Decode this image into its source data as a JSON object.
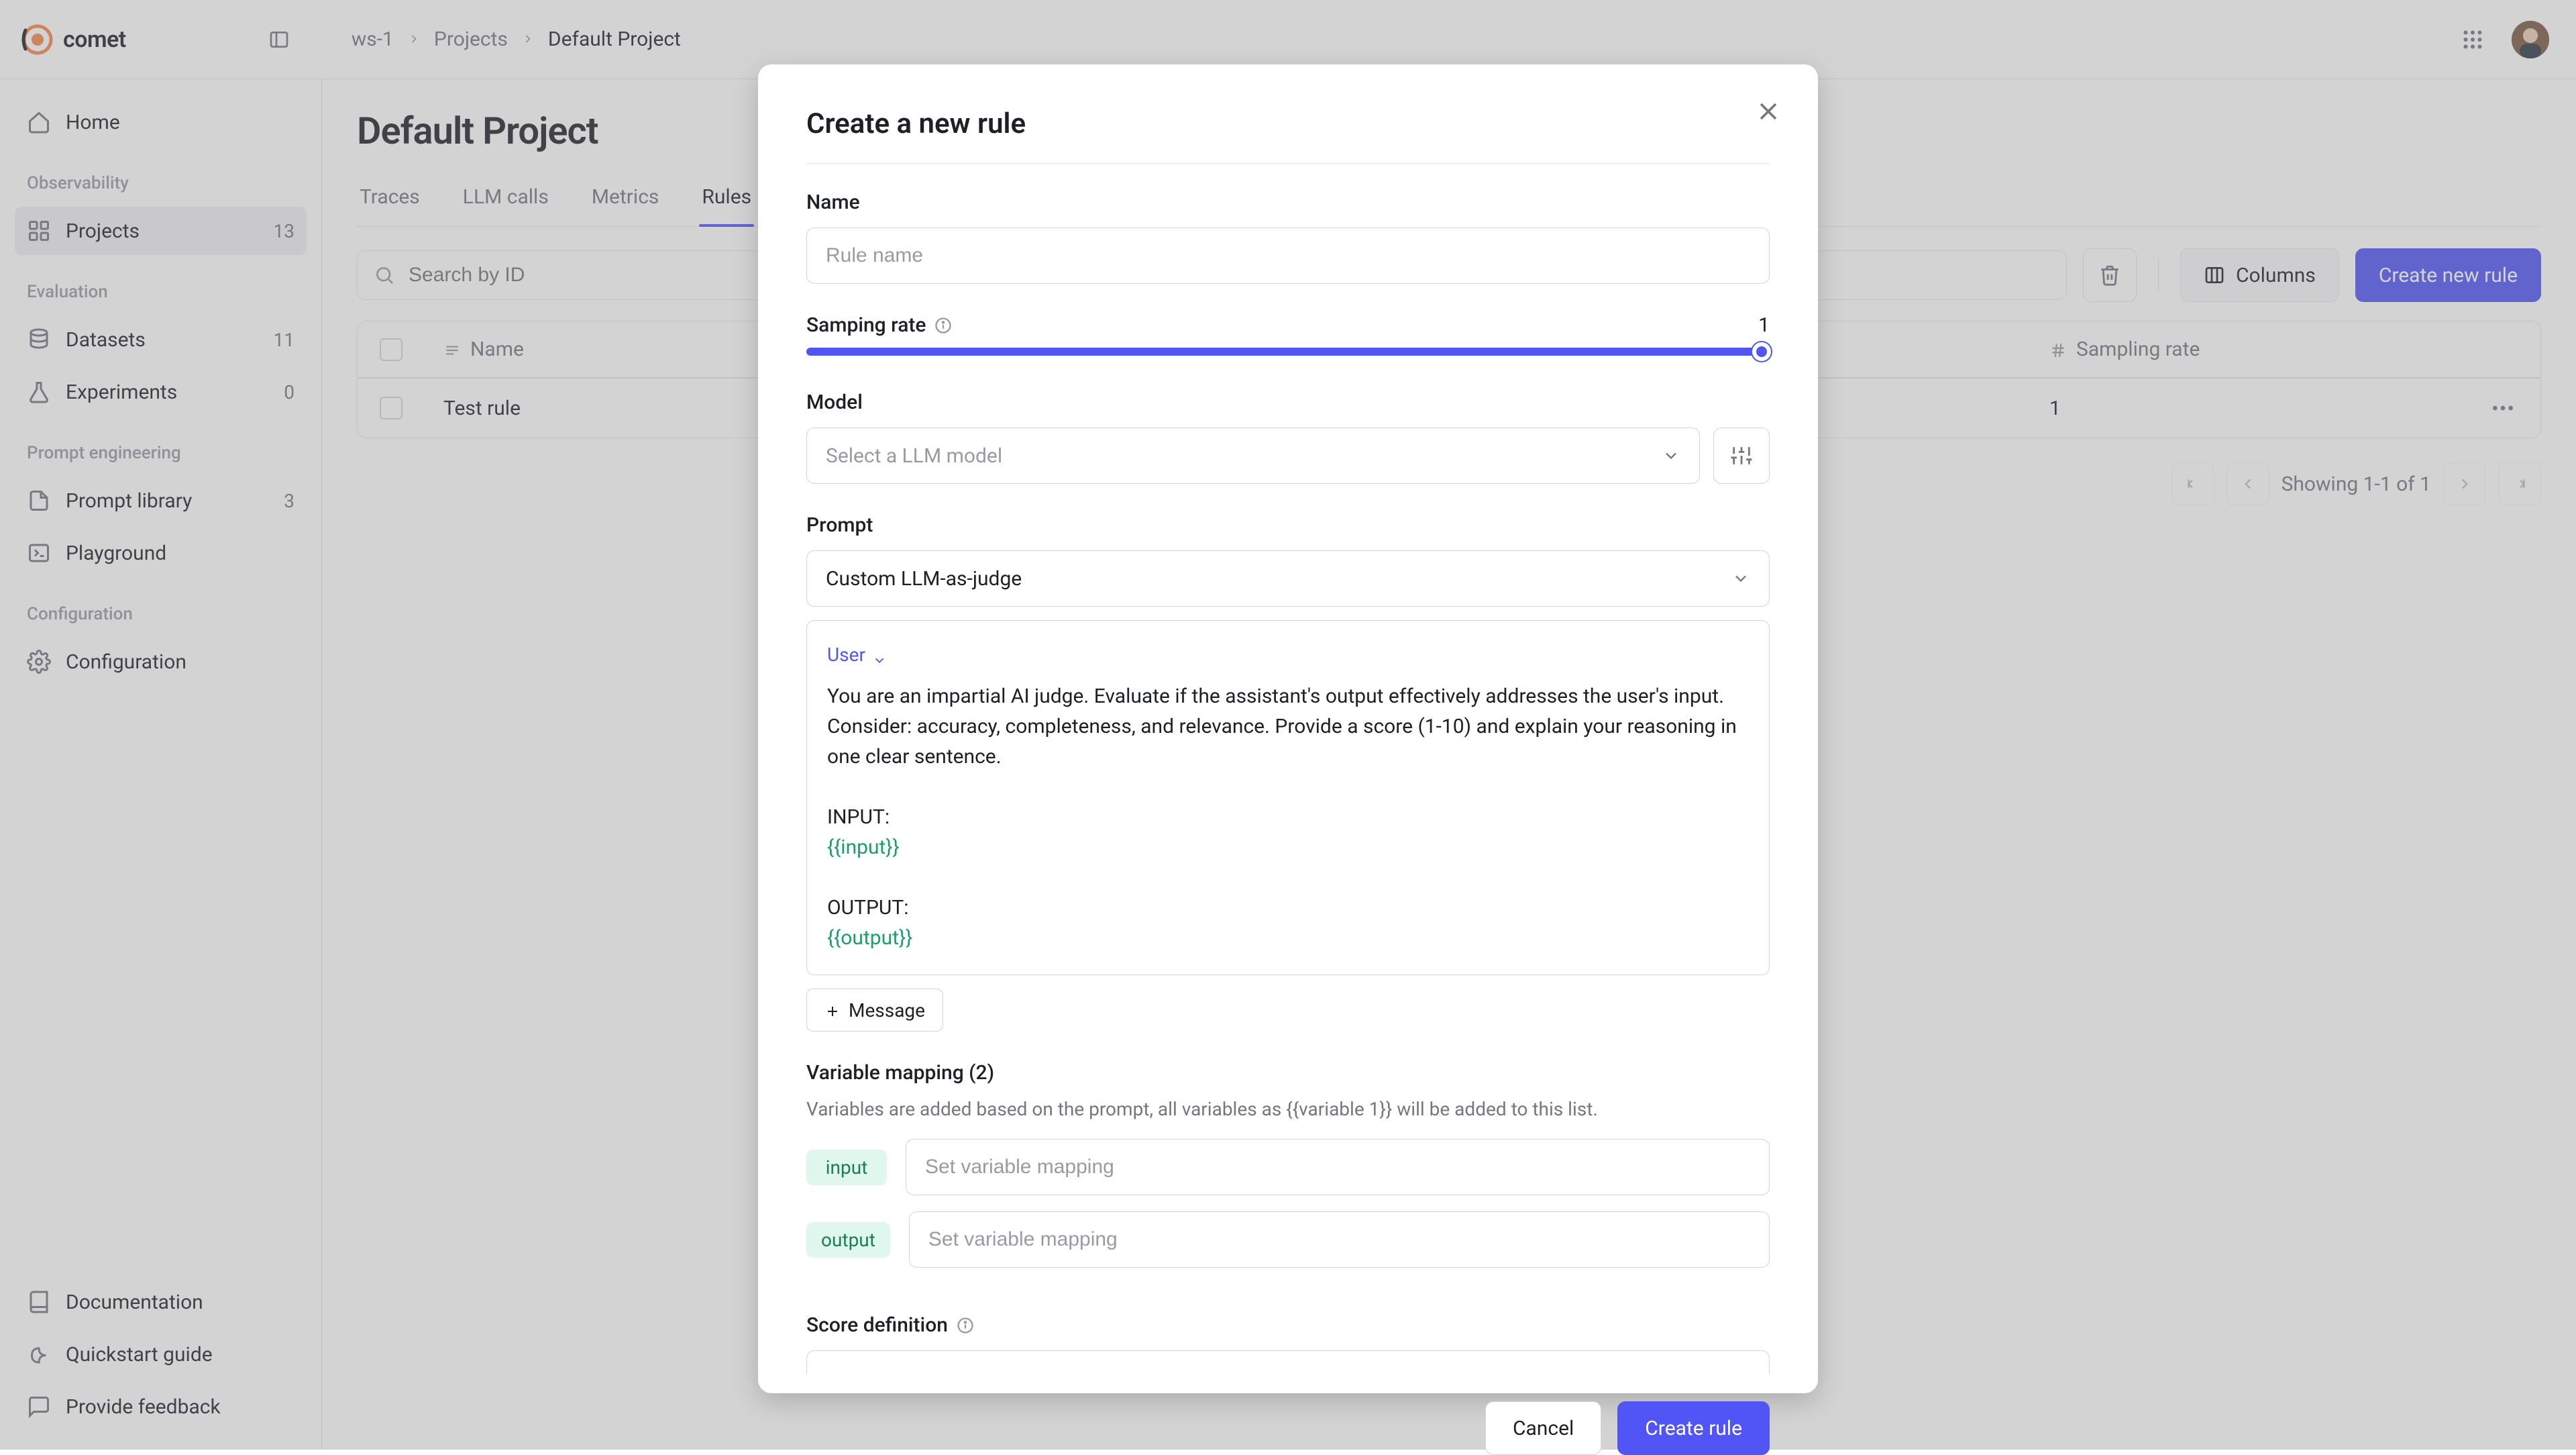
{
  "brand": {
    "name": "comet"
  },
  "breadcrumb": {
    "items": [
      "ws-1",
      "Projects",
      "Default Project"
    ]
  },
  "sidebar": {
    "home": "Home",
    "sections": [
      {
        "label": "Observability",
        "items": [
          {
            "id": "projects",
            "label": "Projects",
            "count": "13",
            "active": true
          }
        ]
      },
      {
        "label": "Evaluation",
        "items": [
          {
            "id": "datasets",
            "label": "Datasets",
            "count": "11"
          },
          {
            "id": "experiments",
            "label": "Experiments",
            "count": "0"
          }
        ]
      },
      {
        "label": "Prompt engineering",
        "items": [
          {
            "id": "prompt-library",
            "label": "Prompt library",
            "count": "3"
          },
          {
            "id": "playground",
            "label": "Playground"
          }
        ]
      },
      {
        "label": "Configuration",
        "items": [
          {
            "id": "configuration",
            "label": "Configuration"
          }
        ]
      }
    ],
    "footer": [
      {
        "id": "documentation",
        "label": "Documentation"
      },
      {
        "id": "quickstart",
        "label": "Quickstart guide"
      },
      {
        "id": "feedback",
        "label": "Provide feedback"
      }
    ]
  },
  "page": {
    "title": "Default Project",
    "tabs": [
      "Traces",
      "LLM calls",
      "Metrics",
      "Rules"
    ],
    "active_tab": "Rules"
  },
  "toolbar": {
    "search_placeholder": "Search by ID",
    "columns_label": "Columns",
    "create_label": "Create new rule"
  },
  "table": {
    "columns": {
      "name": "Name",
      "sampling": "Sampling rate"
    },
    "rows": [
      {
        "name": "Test rule",
        "sampling": "1"
      }
    ]
  },
  "pager": {
    "text": "Showing 1-1 of 1"
  },
  "modal": {
    "title": "Create a new rule",
    "name_label": "Name",
    "name_placeholder": "Rule name",
    "rate_label": "Samping rate",
    "rate_value": "1",
    "model_label": "Model",
    "model_placeholder": "Select a LLM model",
    "prompt_label": "Prompt",
    "prompt_select_value": "Custom LLM-as-judge",
    "role": "User",
    "prompt_text": "You are an impartial AI judge. Evaluate if the assistant's output effectively addresses the user's input. Consider: accuracy, completeness, and relevance. Provide a score (1-10) and explain your reasoning in one clear sentence.",
    "prompt_input_label": "INPUT:",
    "prompt_input_var": "{{input}}",
    "prompt_output_label": "OUTPUT:",
    "prompt_output_var": "{{output}}",
    "message_btn": "Message",
    "varmap_title": "Variable mapping (2)",
    "varmap_help": "Variables are added based on the prompt, all variables as {{variable 1}} will be added to this list.",
    "var1": "input",
    "var2": "output",
    "var_placeholder": "Set variable mapping",
    "score_label": "Score definition",
    "cancel": "Cancel",
    "submit": "Create rule"
  }
}
